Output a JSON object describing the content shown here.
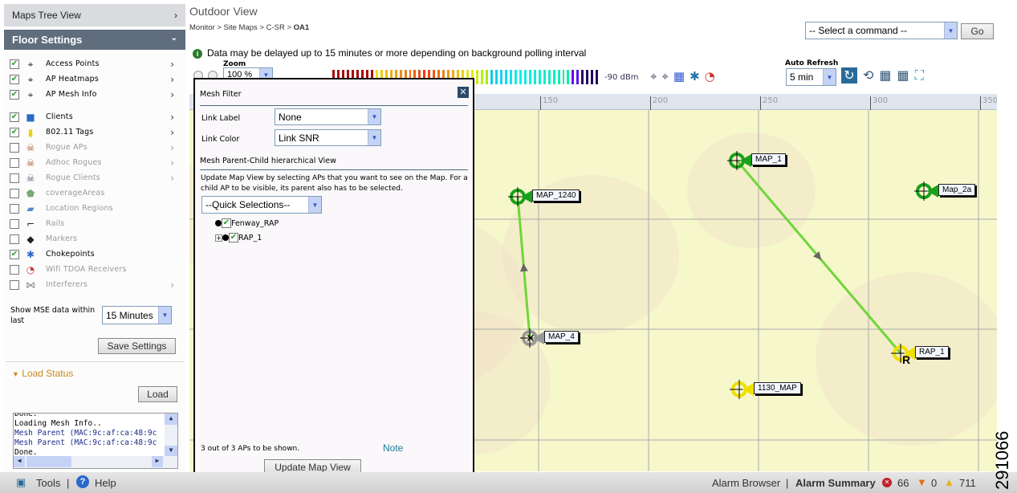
{
  "sidebar": {
    "maps_tree_view": "Maps Tree View",
    "floor_settings": "Floor Settings",
    "layers": [
      {
        "label": "Access Points",
        "checked": true,
        "enabled": true,
        "arrow": true,
        "icon": "access-point-icon"
      },
      {
        "label": "AP Heatmaps",
        "checked": true,
        "enabled": true,
        "arrow": true,
        "icon": "heatmap-icon"
      },
      {
        "label": "AP Mesh Info",
        "checked": true,
        "enabled": true,
        "arrow": true,
        "icon": "mesh-info-icon"
      },
      {
        "label": "Clients",
        "checked": true,
        "enabled": true,
        "arrow": true,
        "icon": "client-icon"
      },
      {
        "label": "802.11 Tags",
        "checked": true,
        "enabled": true,
        "arrow": true,
        "icon": "tag-icon"
      },
      {
        "label": "Rogue APs",
        "checked": false,
        "enabled": false,
        "arrow": true,
        "icon": "rogue-ap-icon"
      },
      {
        "label": "Adhoc Rogues",
        "checked": false,
        "enabled": false,
        "arrow": true,
        "icon": "adhoc-rogue-icon"
      },
      {
        "label": "Rogue Clients",
        "checked": false,
        "enabled": false,
        "arrow": true,
        "icon": "rogue-client-icon"
      },
      {
        "label": "coverageAreas",
        "checked": false,
        "enabled": false,
        "arrow": false,
        "icon": "coverage-area-icon"
      },
      {
        "label": "Location Regions",
        "checked": false,
        "enabled": false,
        "arrow": false,
        "icon": "location-region-icon"
      },
      {
        "label": "Rails",
        "checked": false,
        "enabled": false,
        "arrow": false,
        "icon": "rail-icon"
      },
      {
        "label": "Markers",
        "checked": false,
        "enabled": false,
        "arrow": false,
        "icon": "marker-icon"
      },
      {
        "label": "Chokepoints",
        "checked": true,
        "enabled": true,
        "arrow": false,
        "icon": "chokepoint-icon"
      },
      {
        "label": "Wifi TDOA Receivers",
        "checked": false,
        "enabled": false,
        "arrow": false,
        "icon": "tdoa-receiver-icon"
      },
      {
        "label": "Interferers",
        "checked": false,
        "enabled": false,
        "arrow": true,
        "icon": "interferer-icon"
      }
    ],
    "mse_label": "Show MSE data within last",
    "mse_value": "15 Minutes",
    "save_settings": "Save Settings",
    "load_status": "Load Status",
    "load": "Load",
    "log": [
      "Done.",
      "Loading Mesh Info..",
      "Mesh Parent (MAC:9c:af:ca:48:9c",
      "Mesh Parent (MAC:9c:af:ca:48:9c",
      "Done."
    ]
  },
  "header": {
    "title": "Outdoor View",
    "breadcrumb": [
      "Monitor",
      "Site Maps",
      "C-SR",
      "OA1"
    ],
    "command_select": "-- Select a command --",
    "go": "Go",
    "notice": "Data may be delayed up to 15 minutes or more depending on background polling interval",
    "zoom_label": "Zoom",
    "zoom_value": "100 %",
    "scale_max": "-90 dBm",
    "auto_refresh_label": "Auto Refresh",
    "auto_refresh_value": "5 min"
  },
  "map": {
    "ruler": [
      "150",
      "200",
      "250",
      "300",
      "350"
    ],
    "nodes": [
      {
        "name": "MAP_1240",
        "status": "green"
      },
      {
        "name": "MAP_4",
        "status": "gray"
      },
      {
        "name": "MAP_1",
        "status": "green"
      },
      {
        "name": "Map_2a",
        "status": "green"
      },
      {
        "name": "RAP_1",
        "status": "yellow",
        "badge": "R"
      },
      {
        "name": "1130_MAP",
        "status": "yellow"
      }
    ],
    "links": [
      [
        "MAP_4",
        "MAP_1240"
      ],
      [
        "MAP_1",
        "RAP_1"
      ]
    ]
  },
  "mesh_filter": {
    "title": "Mesh Filter",
    "link_label": "Link Label",
    "link_label_value": "None",
    "link_color": "Link Color",
    "link_color_value": "Link SNR",
    "hier_title": "Mesh Parent-Child hierarchical View",
    "instructions": "Update Map View by selecting APs that you want to see on the Map. For a child AP to be visible, its parent also has to be selected.",
    "quick": "--Quick Selections--",
    "tree": [
      "Fenway_RAP",
      "RAP_1"
    ],
    "count": "3 out of 3 APs to be shown.",
    "note": "Note",
    "update": "Update Map View"
  },
  "footer": {
    "tools": "Tools",
    "help": "Help",
    "alarm_browser": "Alarm Browser",
    "alarm_summary": "Alarm Summary",
    "critical": "66",
    "major": "0",
    "minor": "711"
  },
  "figure_id": "291066",
  "colors": {
    "accent": "#5f6d7c",
    "link": "#6fd63a",
    "load_status": "#c98a1a"
  }
}
